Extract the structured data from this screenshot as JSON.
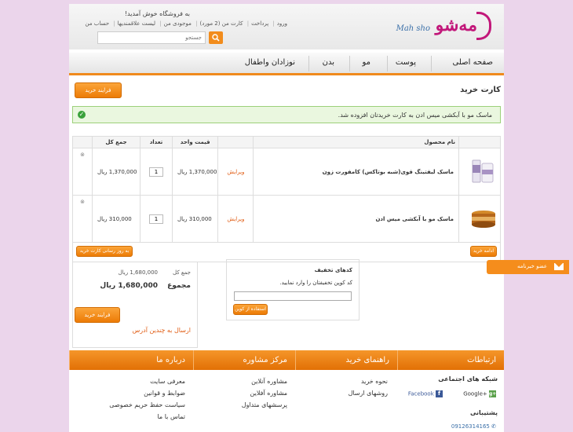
{
  "header": {
    "logo_fa": "مه‌شو",
    "logo_en": "Mah sho",
    "welcome": "به فروشگاه خوش آمدید!",
    "links": [
      "ورود",
      "پرداخت",
      "کارت من (2 مورد)",
      "موجودی من",
      "لیست علاقمندیها",
      "حساب من"
    ],
    "search_placeholder": "جستجو"
  },
  "nav": [
    "صفحه اصلی",
    "پوست",
    "مو",
    "بدن",
    "نوزادان واطفال"
  ],
  "page_title": "کارت خرید",
  "checkout_label": "فرایند خرید",
  "success_message": "ماسک مو با آبکشی میس ادن به کارت خریدتان افزوده شد.",
  "cart": {
    "headers": [
      "نام محصول",
      "",
      "قیمت واحد",
      "تعداد",
      "جمع کل"
    ],
    "items": [
      {
        "name": "ماسک لیفتینگ قوی(شبه بوتاکس) کامفورت زون",
        "edit": "ویرایش",
        "unit_price": "1,370,000 ریال",
        "qty": "1",
        "total": "1,370,000 ریال",
        "remove": "⊗"
      },
      {
        "name": "ماسک مو با آبکشی میس ادن",
        "edit": "ویرایش",
        "unit_price": "310,000 ریال",
        "qty": "1",
        "total": "310,000 ریال",
        "remove": "⊗"
      }
    ],
    "continue_label": "ادامه خرید",
    "update_label": "به روز رسانی کارت خرید"
  },
  "coupon": {
    "title": "کدهای تخفیف",
    "description": "کد کوپن تخفیفتان را وارد نمایید.",
    "apply_label": "استفاده از کوپن"
  },
  "totals": {
    "subtotal_label": "جمع کل",
    "subtotal_value": "1,680,000 ریال",
    "grand_label": "مجموع",
    "grand_value": "1,680,000 ریال",
    "checkout_label": "فرایند خرید",
    "multi_address": "ارسال به چندین آدرس"
  },
  "newsletter": "عضو خبرنامه",
  "footer": {
    "columns": [
      {
        "title": "ارتباطات"
      },
      {
        "title": "راهنمای خرید",
        "items": [
          "نحوه خرید",
          "روشهای ارسال"
        ]
      },
      {
        "title": "مرکز مشاوره",
        "items": [
          "مشاوره آنلاین",
          "مشاوره آفلاین",
          "پرسشهای متداول"
        ]
      },
      {
        "title": "درباره ما",
        "items": [
          "معرفی سایت",
          "ضوابط و قوانین",
          "سیاست حفظ حریم خصوصی",
          "تماس با ما"
        ]
      }
    ],
    "social_title": "شبکه های اجتماعی",
    "facebook": "Facebook",
    "google": "Google+",
    "support_title": "پشتیبانی",
    "phone": "09126314165"
  }
}
